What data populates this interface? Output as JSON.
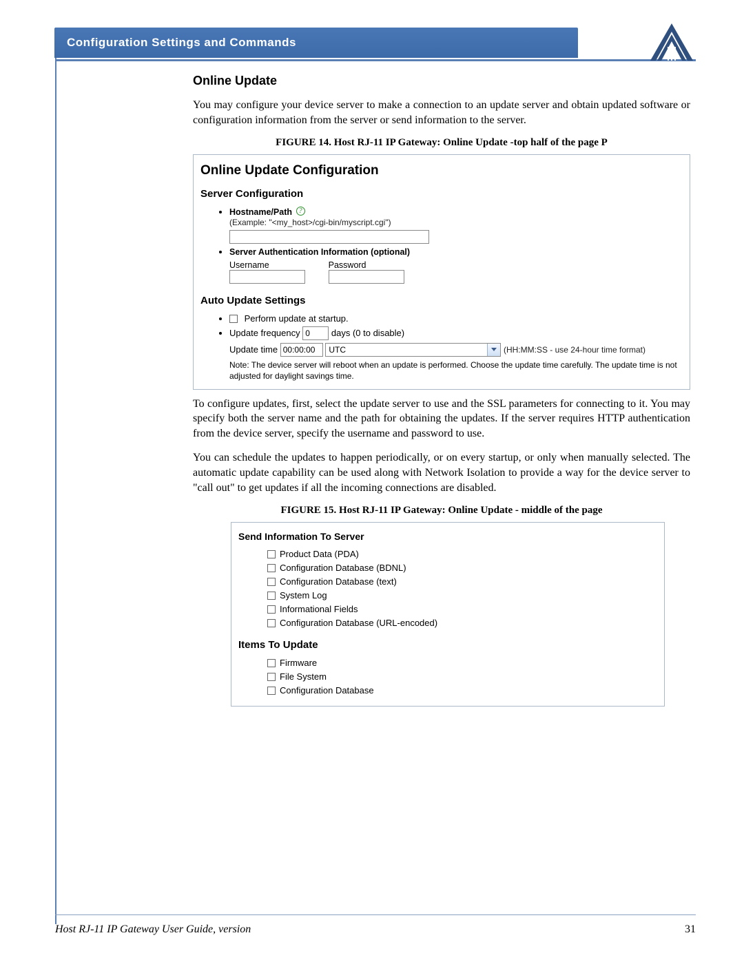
{
  "header": {
    "title": "Configuration Settings and Commands"
  },
  "section": {
    "title": "Online Update",
    "intro": "You may configure your device server to make a connection to an update server and obtain updated software or configuration information from the server or send information to the server.",
    "para2": "To configure updates, first, select the update server to use and the SSL parameters for connecting to it. You may specify both the server name and the path for obtaining the updates. If the server requires HTTP authentication from the device server, specify the username and password to use.",
    "para3": "You can schedule the updates to happen periodically, or on every startup, or only when manually selected. The automatic update capability can be used along with Network Isolation to provide a way for the device server to \"call out\" to get updates if all the incoming connections are disabled."
  },
  "figure14": {
    "caption": "FIGURE 14.  Host RJ-11 IP Gateway: Online Update -top half of the page P",
    "title": "Online Update Configuration",
    "server_config": "Server Configuration",
    "hostname_label": "Hostname/Path",
    "hostname_example": "(Example: \"<my_host>/cgi-bin/myscript.cgi\")",
    "auth_label": "Server Authentication Information (optional)",
    "username_label": "Username",
    "password_label": "Password",
    "auto_title": "Auto Update Settings",
    "perform_label": "Perform update at startup.",
    "freq_pre": "Update frequency",
    "freq_value": "0",
    "freq_post": "days (0 to disable)",
    "time_pre": "Update time",
    "time_value": "00:00:00",
    "tz_value": "UTC",
    "time_hint": "(HH:MM:SS - use 24-hour time format)",
    "note": "Note: The device server will reboot when an update is performed. Choose the update time carefully. The update time is not adjusted for daylight savings time."
  },
  "figure15": {
    "caption": "FIGURE 15.  Host RJ-11 IP Gateway: Online Update - middle of the page",
    "send_title": "Send Information To Server",
    "send_items": [
      "Product Data (PDA)",
      "Configuration Database (BDNL)",
      "Configuration Database (text)",
      "System Log",
      "Informational Fields",
      "Configuration Database (URL-encoded)"
    ],
    "update_title": "Items To Update",
    "update_items": [
      "Firmware",
      "File System",
      "Configuration Database"
    ]
  },
  "footer": {
    "left": "Host RJ-11 IP Gateway User Guide, version",
    "page": "31"
  }
}
